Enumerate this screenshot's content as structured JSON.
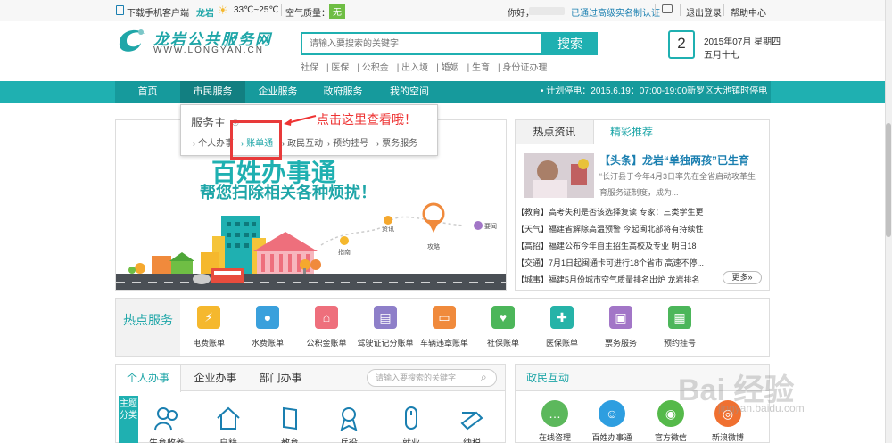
{
  "topbar": {
    "download": "下载手机客户端",
    "city": "龙岩",
    "temperature": "33℃~25℃",
    "air_label": "空气质量：",
    "air_value": "无",
    "greeting": "你好，",
    "verified": "已通过高级实名制认证",
    "logout": "退出登录",
    "help": "帮助中心"
  },
  "header": {
    "logo_cn": "龙岩公共服务网",
    "logo_en": "WWW.LONGYAN.CN",
    "search_placeholder": "请输入要搜索的关键字",
    "search_button": "搜索",
    "quick_links": [
      "社保",
      "医保",
      "公积金",
      "出入境",
      "婚姻",
      "生育",
      "身份证办理"
    ],
    "calendar_day": "2",
    "date_line1": "2015年07月 星期四",
    "date_line2": "五月十七"
  },
  "nav": {
    "items": [
      "首页",
      "市民服务",
      "企业服务",
      "政府服务",
      "我的空间"
    ],
    "notice": "• 计划停电：2015.6.19：07:00-19:00新罗区大池镇时停电"
  },
  "dropdown": {
    "title": "服务主",
    "items": [
      "› 个人办事",
      "› 账单通",
      "› 政民互动",
      "› 预约挂号",
      "› 票务服务"
    ],
    "callout": "点击这里查看哦！"
  },
  "banner": {
    "headline": "百姓办事通",
    "subline": "帮您扫除相关各种烦扰！",
    "pins": [
      "指南",
      "资讯",
      "攻略",
      "要闻"
    ]
  },
  "news": {
    "tab_hot": "热点资讯",
    "tab_recommend": "精彩推荐",
    "headline_title": "【头条】龙岩“单独两孩”已生育",
    "headline_summary_1": "“长汀县于今年4月3日率先在全省启动攻革生",
    "headline_summary_2": "育服务证制度，成为...",
    "items": [
      "【教育】高考失利是否该选择复读 专家：三类学生更",
      "【天气】福建省解除高温预警 今起闽北部将有持续性",
      "【高招】福建公布今年自主招生高校及专业 明日18",
      "【交通】7月1日起闽通卡可进行18个省市 高速不停...",
      "【城事】福建5月份城市空气质量排名出炉 龙岩排名"
    ],
    "more": "更多»"
  },
  "hot_services": {
    "label": "热点服务",
    "items": [
      {
        "label": "电费账单",
        "icon": "lightning-icon",
        "color": "#f5b82e"
      },
      {
        "label": "水费账单",
        "icon": "water-drop-icon",
        "color": "#3aa0dc"
      },
      {
        "label": "公积金账单",
        "icon": "house-icon",
        "color": "#ee6f7c"
      },
      {
        "label": "驾驶证记分账单",
        "icon": "id-card-icon",
        "color": "#8e7fc9"
      },
      {
        "label": "车辆违章账单",
        "icon": "car-icon",
        "color": "#f08a3c"
      },
      {
        "label": "社保账单",
        "icon": "shield-icon",
        "color": "#4cb65a"
      },
      {
        "label": "医保账单",
        "icon": "medkit-icon",
        "color": "#26b3a8"
      },
      {
        "label": "票务服务",
        "icon": "ticket-icon",
        "color": "#a276c7"
      },
      {
        "label": "预约挂号",
        "icon": "hospital-icon",
        "color": "#4cb65a"
      }
    ]
  },
  "affairs": {
    "tabs": [
      "个人办事",
      "企业办事",
      "部门办事"
    ],
    "search_placeholder": "请输入要搜索的关键字",
    "topic_label": "主题分类",
    "items": [
      "生育收养",
      "户籍",
      "教育",
      "兵役",
      "就业",
      "纳税"
    ]
  },
  "interaction": {
    "title": "政民互动",
    "items": [
      {
        "label": "在线咨理",
        "color": "#5cb85c"
      },
      {
        "label": "百姓办事通",
        "color": "#2e9ee0"
      },
      {
        "label": "官方微信",
        "color": "#55b94a"
      },
      {
        "label": "新浪微博",
        "color": "#f07030"
      }
    ]
  },
  "watermark": {
    "text": "Bai 经验",
    "url": "jingyan.baidu.com"
  }
}
